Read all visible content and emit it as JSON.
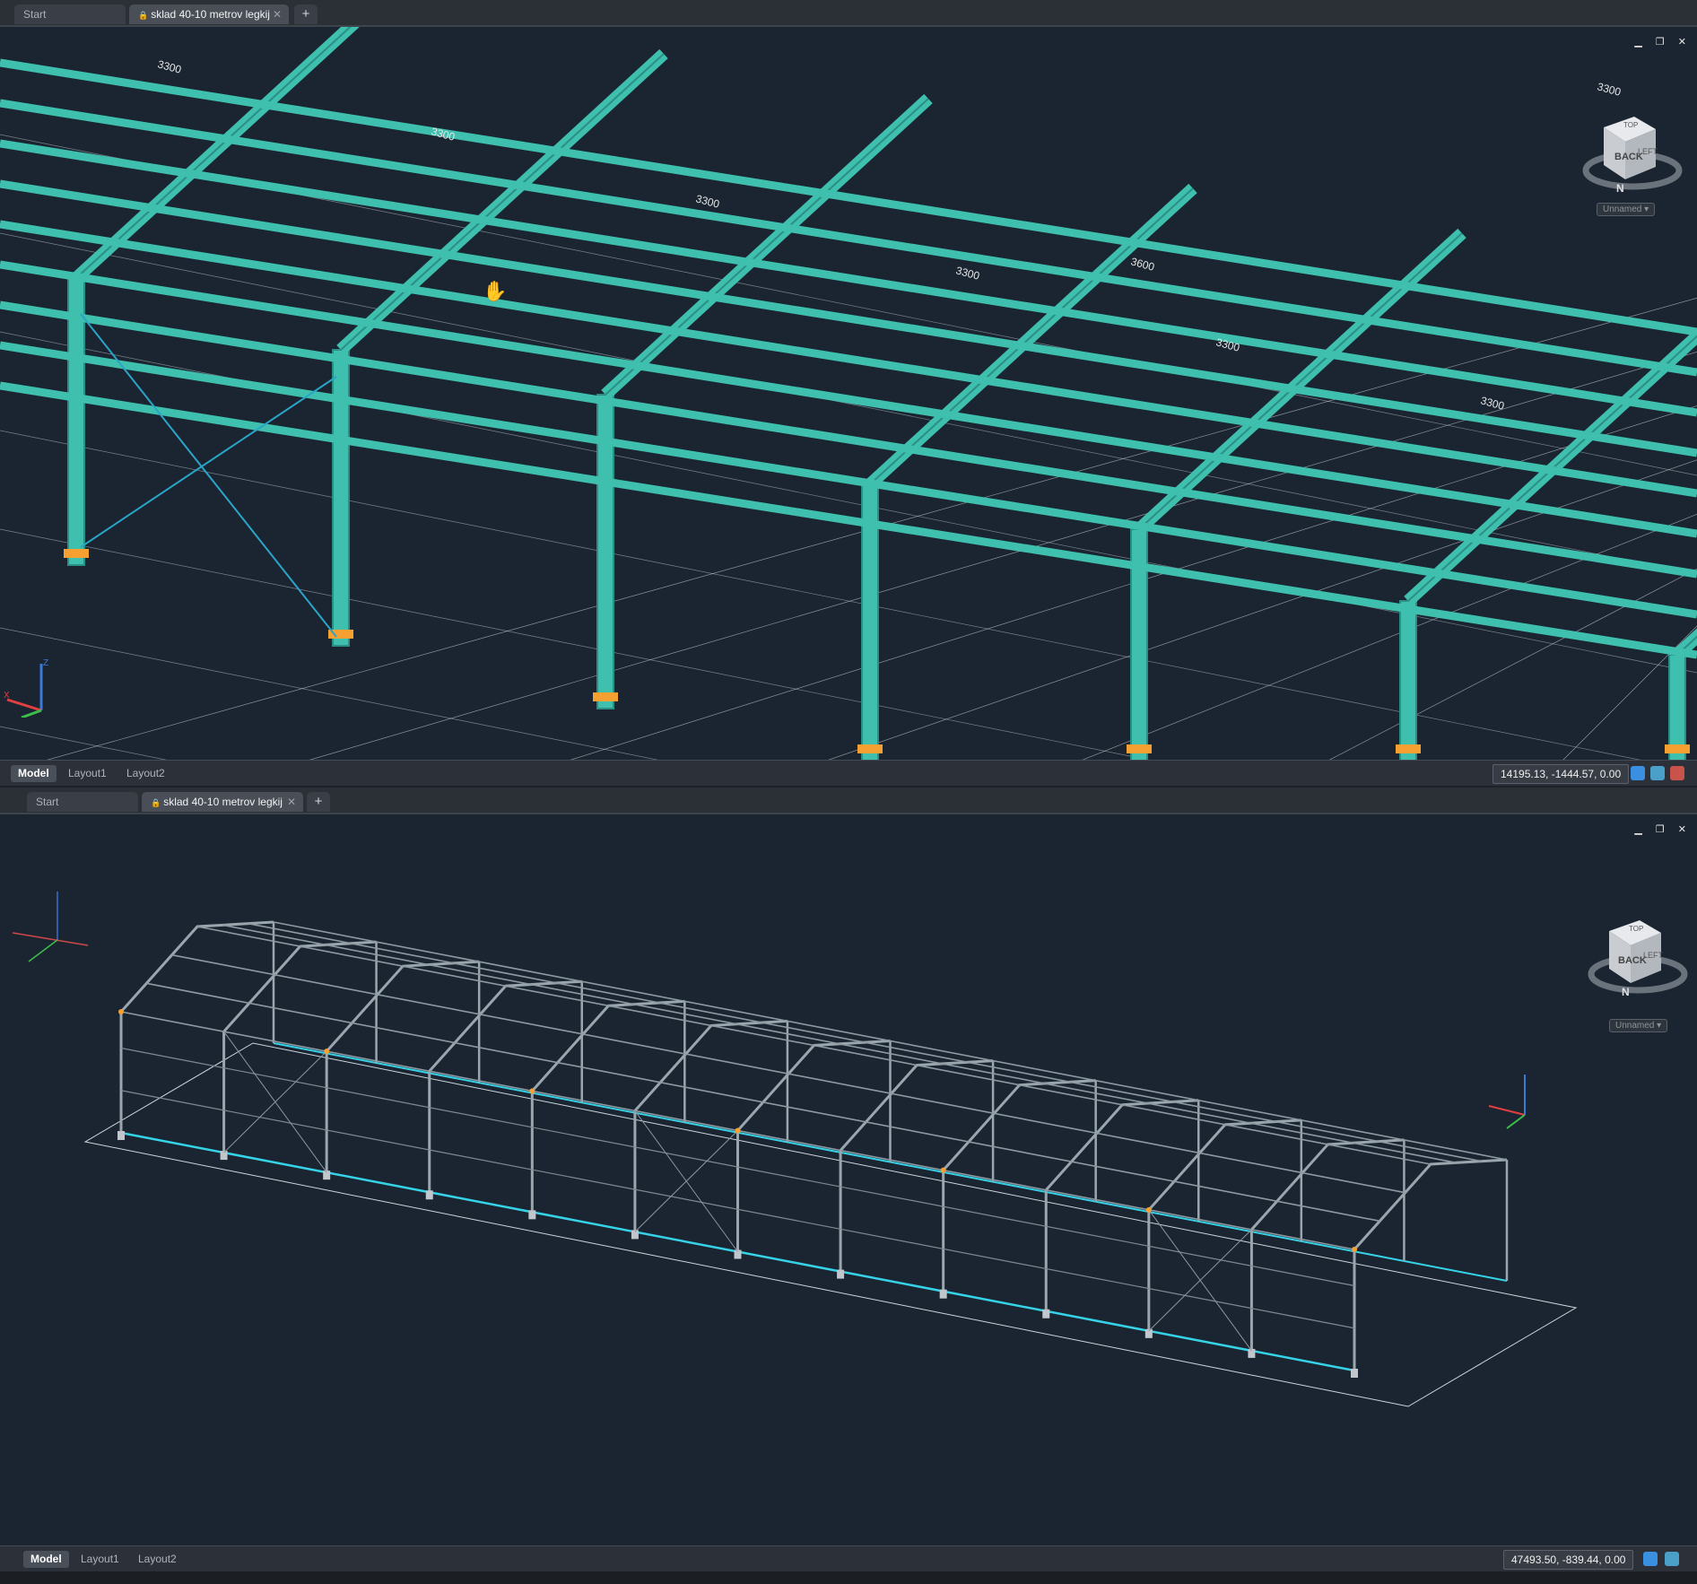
{
  "top": {
    "tabs": {
      "start": "Start",
      "doc": "sklad 40-10 metrov legkij",
      "plus": "+"
    },
    "layouts": [
      "Model",
      "Layout1",
      "Layout2"
    ],
    "coordinates": "14195.13, -1444.57, 0.00",
    "viewcube": {
      "face": "BACK",
      "right": "LEFT",
      "top": "TOP",
      "compass": "N",
      "named_view": "Unnamed"
    },
    "dimension_labels": [
      "3300",
      "3300",
      "3300",
      "3300",
      "3600",
      "3300",
      "3300",
      "3300"
    ]
  },
  "bottom": {
    "tabs": {
      "start": "Start",
      "doc": "sklad 40-10 metrov legkij",
      "plus": "+"
    },
    "layouts": [
      "Model",
      "Layout1",
      "Layout2"
    ],
    "coordinates": "47493.50, -839.44, 0.00",
    "viewcube": {
      "face": "BACK",
      "right": "LEFT",
      "top": "TOP",
      "compass": "N",
      "named_view": "Unnamed"
    }
  },
  "colors": {
    "frame": "#3fbfae",
    "frame_dark": "#2a8f84",
    "grid": "#d7dce1",
    "accent_orange": "#f5a030",
    "bg": "#1a2531"
  }
}
